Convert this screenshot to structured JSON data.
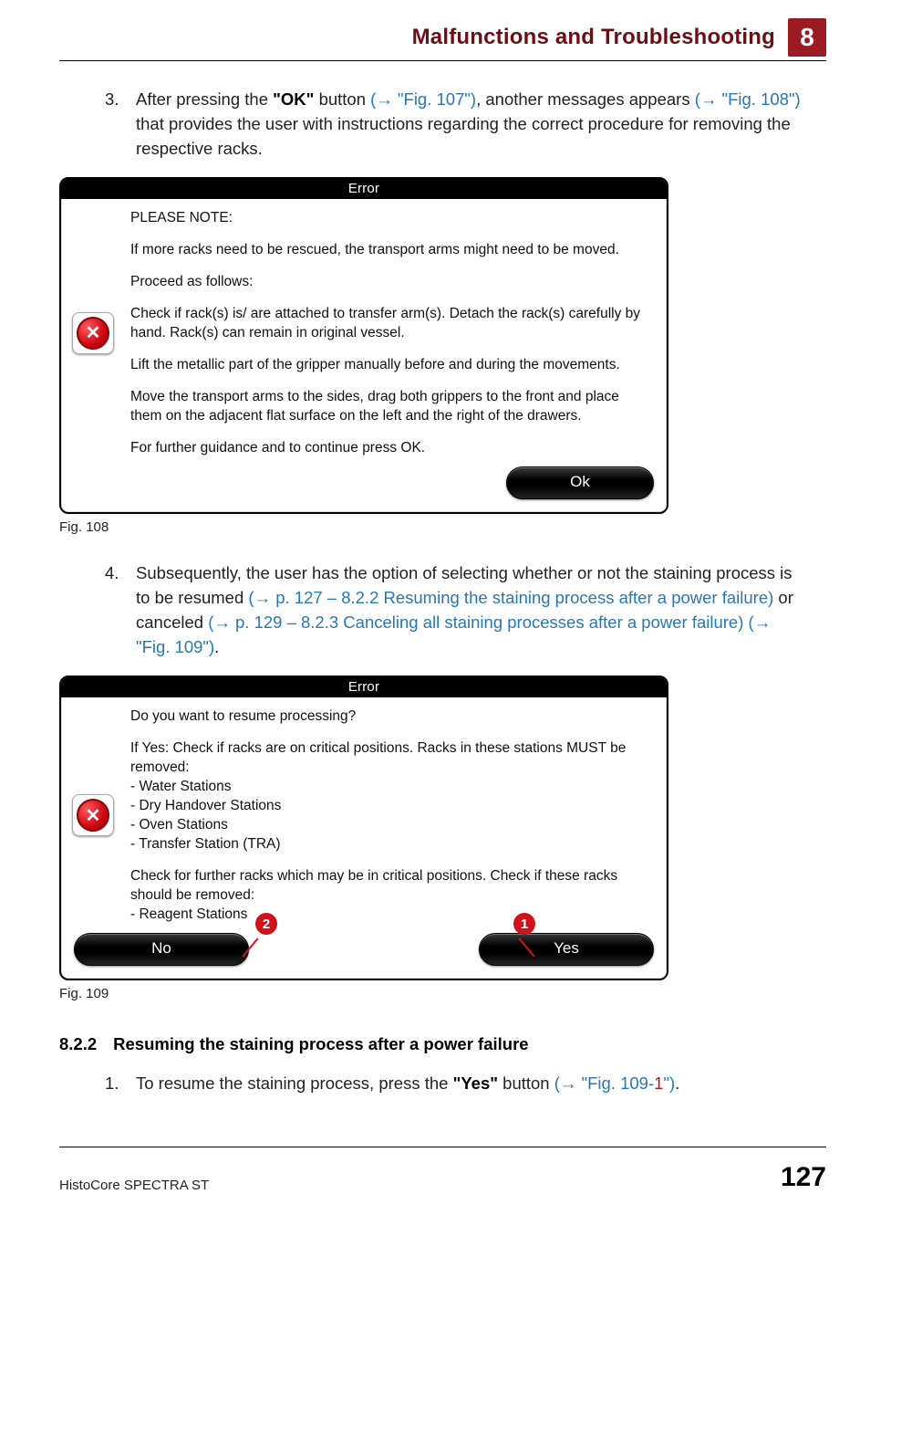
{
  "header": {
    "section": "Malfunctions and Troubleshooting",
    "chapter": "8"
  },
  "step3": {
    "num": "3.",
    "t1": "After pressing the ",
    "ok": "\"OK\"",
    "t2": " button ",
    "link1": "(→ \"Fig. 107\")",
    "t3": ", another messages appears ",
    "link2": "(→ \"Fig. 108\")",
    "t4": " that provides the user with instructions regarding the correct procedure for removing the respective racks."
  },
  "dialog108": {
    "title": "Error",
    "p1": "PLEASE NOTE:",
    "p2": "If more racks need to be rescued, the transport arms might need to be moved.",
    "p3": "Proceed as follows:",
    "p4": "Check if rack(s) is/ are attached to transfer arm(s). Detach the rack(s) carefully by hand. Rack(s) can remain in original vessel.",
    "p5": "Lift the metallic part of the gripper manually before and during the movements.",
    "p6": "Move the transport arms to the sides, drag both grippers to the front and place them on the adjacent flat surface on the left  and the right of the drawers.",
    "p7": "For further guidance and to continue press OK.",
    "ok": "Ok",
    "caption": "Fig. 108"
  },
  "step4": {
    "num": "4.",
    "t1": "Subsequently, the user has the option of selecting whether or not the staining process is to be resumed ",
    "link1": "(→ p. 127 – 8.2.2 Resuming the staining process after a power failure)",
    "t2": " or canceled ",
    "link2": "(→ p. 129 – 8.2.3 Canceling all staining processes after a power failure)",
    "spacer": " ",
    "link3": "(→ \"Fig. 109\")",
    "t3": "."
  },
  "dialog109": {
    "title": "Error",
    "p1": "Do you want to resume processing?",
    "p2": "If Yes: Check if racks are on critical positions. Racks in these stations MUST be removed:",
    "li1": "- Water Stations",
    "li2": "- Dry Handover Stations",
    "li3": "- Oven Stations",
    "li4": "- Transfer Station (TRA)",
    "p3": "Check for further racks which may be in critical positions. Check if these racks should be removed:",
    "li5": "- Reagent Stations",
    "no": "No",
    "yes": "Yes",
    "caption": "Fig. 109",
    "badge1": "1",
    "badge2": "2"
  },
  "section": {
    "num": "8.2.2",
    "title": "Resuming the staining process after a power failure"
  },
  "step1b": {
    "num": "1.",
    "t1": "To resume the staining process, press the ",
    "yes": "\"Yes\"",
    "t2": " button ",
    "linkA": "(→ \"Fig. 109",
    "dash": "-",
    "red1": "1",
    "linkB": "\")",
    "t3": "."
  },
  "footer": {
    "left": "HistoCore SPECTRA ST",
    "right": "127"
  }
}
